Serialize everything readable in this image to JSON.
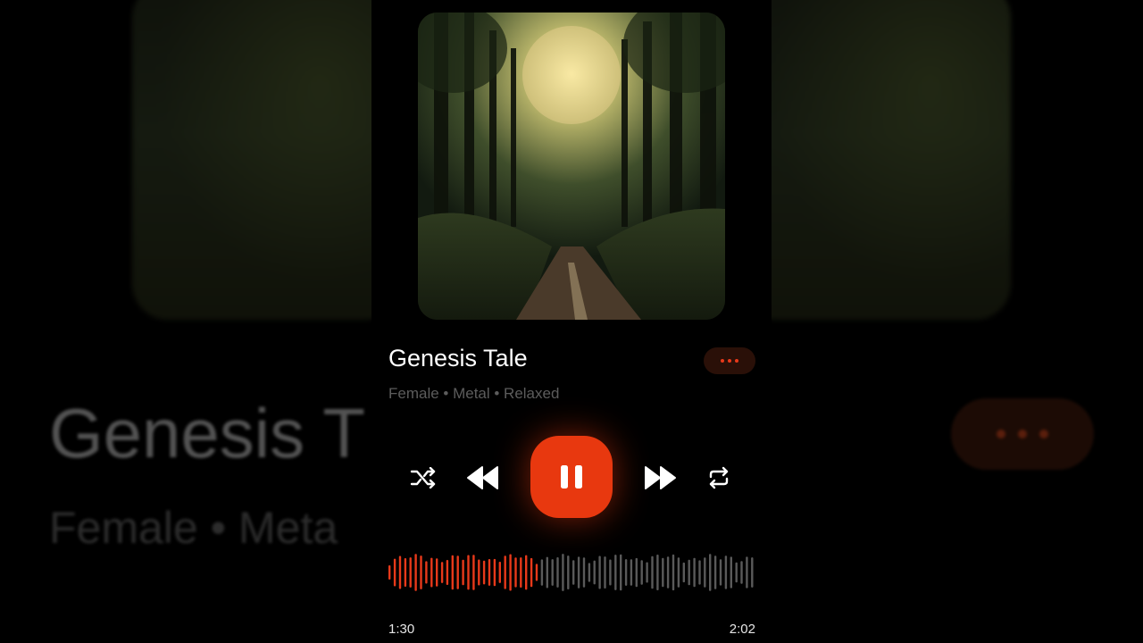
{
  "track": {
    "title": "Genesis Tale",
    "subtitle": "Female • Metal • Relaxed"
  },
  "background": {
    "title_fragment": "Genesis T",
    "subtitle_fragment": "Female • Meta"
  },
  "controls": {
    "shuffle": "shuffle-icon",
    "previous": "rewind-icon",
    "play_pause": "pause-icon",
    "next": "fast-forward-icon",
    "repeat": "repeat-icon"
  },
  "progress": {
    "elapsed": "1:30",
    "duration": "2:02",
    "played_fraction": 0.41
  },
  "colors": {
    "accent": "#E8380F",
    "wave_played": "#E8391A",
    "wave_unplayed": "#5A5A5A"
  }
}
